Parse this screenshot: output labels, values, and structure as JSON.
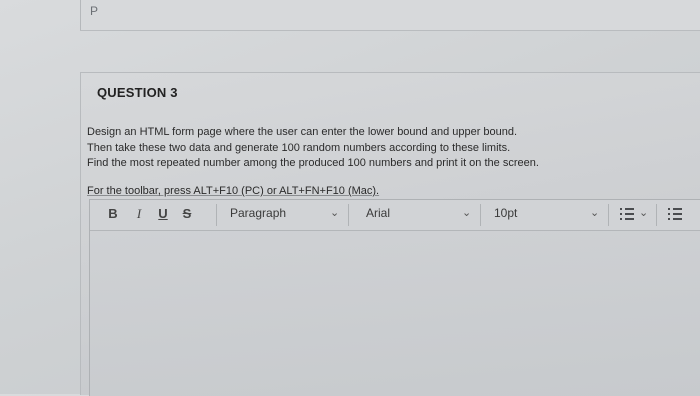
{
  "header": {
    "page_marker": "P"
  },
  "question": {
    "title": "QUESTION 3",
    "lines": [
      "Design an HTML form page where the user can enter the lower bound and upper bound.",
      "Then take these two data and generate 100 random numbers according to these limits.",
      "Find the most repeated number among the produced 100 numbers and print it on the screen."
    ],
    "toolbar_hint": "For the toolbar, press ALT+F10 (PC) or ALT+FN+F10 (Mac)."
  },
  "toolbar": {
    "bold": "B",
    "italic": "I",
    "underline": "U",
    "strikethrough": "S",
    "paragraph_style": "Paragraph",
    "font_family": "Arial",
    "font_size": "10pt",
    "chevron": "⌄"
  },
  "editor": {
    "content": ""
  }
}
